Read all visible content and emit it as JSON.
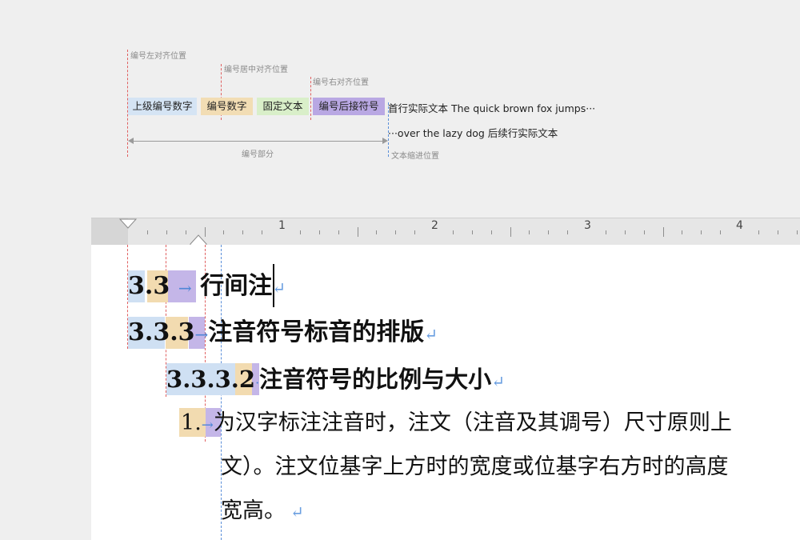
{
  "diagram": {
    "label_left_align": "编号左对齐位置",
    "label_center_align": "编号居中对齐位置",
    "label_right_align": "编号右对齐位置",
    "box_parent_number": "上级编号数字",
    "box_number": "编号数字",
    "box_fixed_text": "固定文本",
    "box_trailing_symbol": "编号后接符号",
    "first_line_text": "首行实际文本 The quick brown fox jumps···",
    "continuation_text": "···over the lazy dog 后续行实际文本",
    "numbering_part": "编号部分",
    "text_indent_position": "文本缩进位置",
    "colors": {
      "parent_number": "#d5e4f4",
      "number": "#f2ddb4",
      "fixed_text": "#d9efc9",
      "trailing_symbol": "#b9a8e3",
      "red_guide": "#e06060",
      "blue_guide": "#5b8fd9"
    }
  },
  "ruler": {
    "numbers": [
      "1",
      "2",
      "3",
      "4"
    ]
  },
  "document": {
    "h1": {
      "num_a": "3",
      "dot": ".",
      "num_b": "3",
      "tab": "→",
      "text": "行间注",
      "ret": "↵"
    },
    "h2": {
      "num_a": "3",
      "dot1": ".",
      "num_b": "3",
      "dot2": ".",
      "num_c": "3",
      "tab": "→",
      "text": "注音符号标音的排版",
      "ret": "↵"
    },
    "h3": {
      "num_a": "3",
      "dot1": ".",
      "num_b": "3",
      "dot2": ".",
      "num_c": "3",
      "dot3": ".",
      "num_d": "2",
      "sep": "·",
      "text": "注音符号的比例与大小",
      "ret": "↵"
    },
    "p1": {
      "num": "1",
      "dot": ".",
      "tab": "→",
      "line1": "为汉字标注注音时，注文（注音及其调号）尺寸原则上",
      "line2": "文）。注文位基字上方时的宽度或位基字右方时的高度",
      "line3": "宽高。",
      "ret": "↵"
    }
  }
}
